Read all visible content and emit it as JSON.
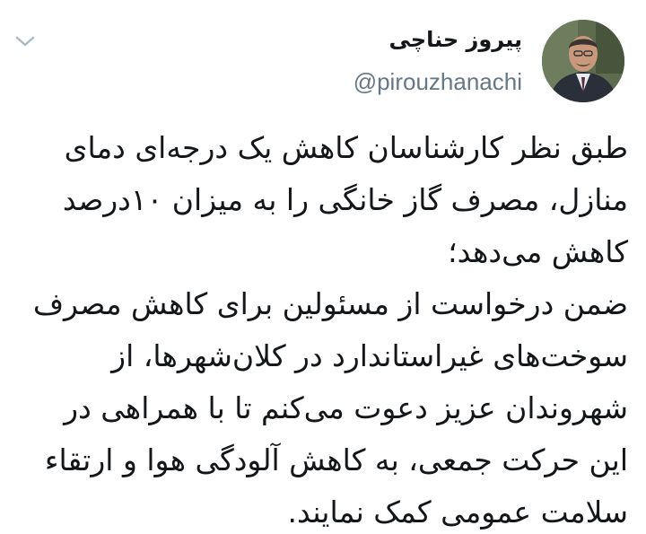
{
  "author": {
    "display_name": "پیروز حناچی",
    "handle": "@pirouzhanachi"
  },
  "menu": {
    "icon": "chevron-down-icon"
  },
  "tweet": {
    "lines": [
      "طبق نظر کارشناسان کاهش یک درجه‌ای دمای",
      "منازل، مصرف گاز خانگی را به میزان ۱۰درصد",
      "کاهش می‌دهد؛",
      "ضمن درخواست از مسئولین برای کاهش مصرف",
      "سوخت‌های غیراستاندارد در کلان‌شهرها، از",
      "شهروندان عزیز دعوت می‌کنم تا با همراهی در",
      "این حرکت جمعی، به کاهش آلودگی هوا و ارتقاء",
      "سلامت عمومی کمک نمایند."
    ]
  },
  "colors": {
    "text": "#14171a",
    "secondary": "#657786",
    "chevron": "#aab8c2"
  }
}
